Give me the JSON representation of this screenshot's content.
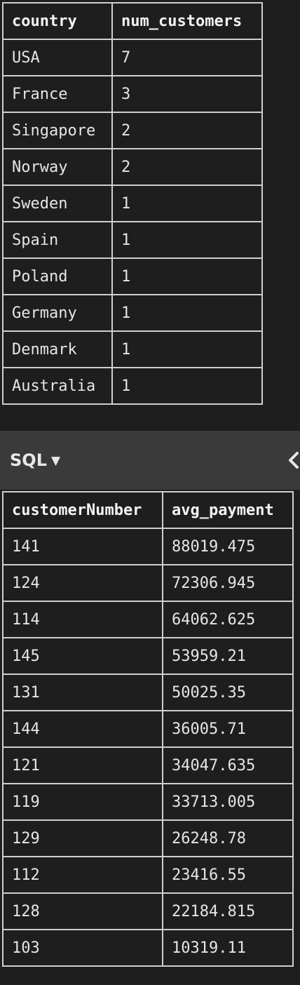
{
  "table1": {
    "headers": [
      "country",
      "num_customers"
    ],
    "rows": [
      [
        "USA",
        "7"
      ],
      [
        "France",
        "3"
      ],
      [
        "Singapore",
        "2"
      ],
      [
        "Norway",
        "2"
      ],
      [
        "Sweden",
        "1"
      ],
      [
        "Spain",
        "1"
      ],
      [
        "Poland",
        "1"
      ],
      [
        "Germany",
        "1"
      ],
      [
        "Denmark",
        "1"
      ],
      [
        "Australia",
        "1"
      ]
    ]
  },
  "toolbar": {
    "mode_label": "SQL",
    "caret": "▼",
    "icons": [
      "caret-down-icon",
      "chevron-left-icon"
    ]
  },
  "table2": {
    "headers": [
      "customerNumber",
      "avg_payment"
    ],
    "rows": [
      [
        "141",
        "88019.475"
      ],
      [
        "124",
        "72306.945"
      ],
      [
        "114",
        "64062.625"
      ],
      [
        "145",
        "53959.21"
      ],
      [
        "131",
        "50025.35"
      ],
      [
        "144",
        "36005.71"
      ],
      [
        "121",
        "34047.635"
      ],
      [
        "119",
        "33713.005"
      ],
      [
        "129",
        "26248.78"
      ],
      [
        "112",
        "23416.55"
      ],
      [
        "128",
        "22184.815"
      ],
      [
        "103",
        "10319.11"
      ]
    ]
  }
}
